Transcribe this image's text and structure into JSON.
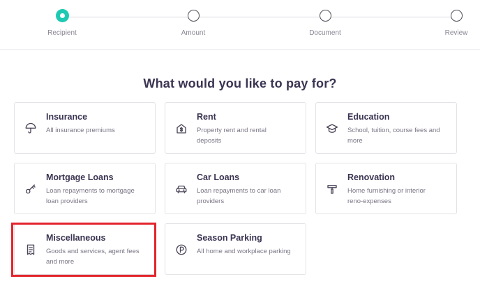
{
  "steps": [
    {
      "label": "Recipient",
      "state": "active"
    },
    {
      "label": "Amount",
      "state": "pending"
    },
    {
      "label": "Document",
      "state": "pending"
    },
    {
      "label": "Review",
      "state": "pending"
    }
  ],
  "title": "What would you like to pay for?",
  "categories": [
    {
      "name": "Insurance",
      "desc": "All insurance premiums",
      "icon": "umbrella-icon"
    },
    {
      "name": "Rent",
      "desc": "Property rent and rental deposits",
      "icon": "house-dollar-icon"
    },
    {
      "name": "Education",
      "desc": "School, tuition, course fees and more",
      "icon": "graduation-cap-icon"
    },
    {
      "name": "Mortgage Loans",
      "desc": "Loan repayments to mortgage loan providers",
      "icon": "key-icon"
    },
    {
      "name": "Car Loans",
      "desc": "Loan repayments to car loan providers",
      "icon": "car-icon"
    },
    {
      "name": "Renovation",
      "desc": "Home furnishing or interior reno-expenses",
      "icon": "paint-roller-icon"
    },
    {
      "name": "Miscellaneous",
      "desc": "Goods and services, agent fees and more",
      "icon": "receipt-icon"
    },
    {
      "name": "Season Parking",
      "desc": "All home and workplace parking",
      "icon": "parking-icon"
    }
  ],
  "colors": {
    "active_step": "#1fc9b2",
    "highlight": "#e3242b",
    "text": "#3b3452"
  }
}
